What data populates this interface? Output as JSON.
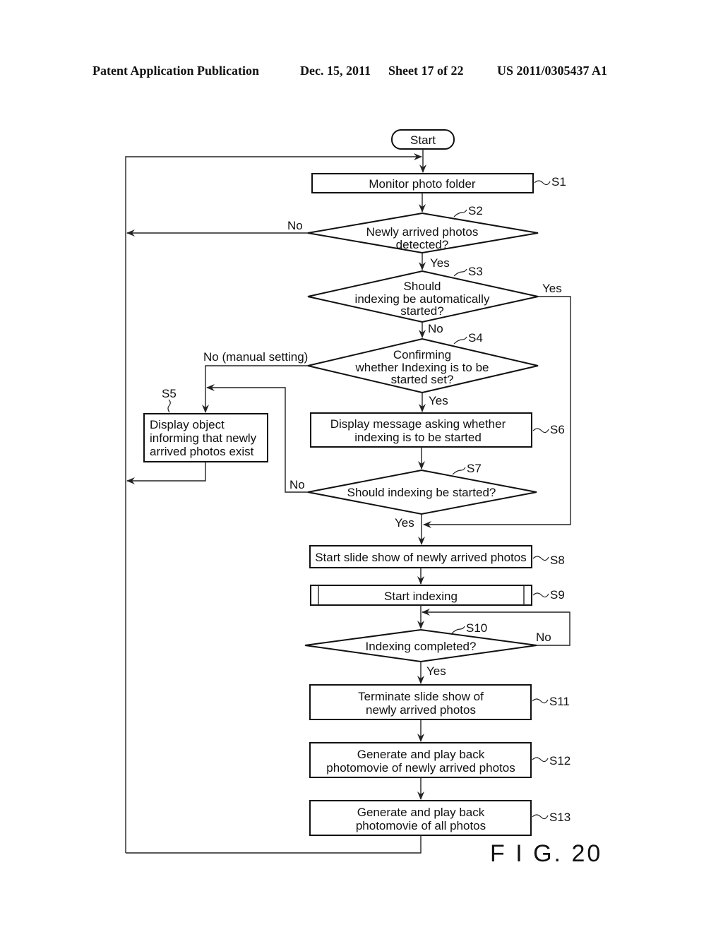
{
  "header": {
    "publication": "Patent Application Publication",
    "date": "Dec. 15, 2011",
    "sheet": "Sheet 17 of 22",
    "number": "US 2011/0305437 A1"
  },
  "figure_label": "F I G. 20",
  "start": "Start",
  "steps": {
    "s1": {
      "id": "S1",
      "lines": [
        "Monitor photo folder"
      ]
    },
    "s2": {
      "id": "S2",
      "lines": [
        "Newly arrived photos",
        "detected?"
      ]
    },
    "s3": {
      "id": "S3",
      "lines": [
        "Should",
        "indexing be automatically",
        "started?"
      ]
    },
    "s4": {
      "id": "S4",
      "lines": [
        "Confirming",
        "whether Indexing is to be",
        "started set?"
      ]
    },
    "s5": {
      "id": "S5",
      "lines": [
        "Display object",
        "informing that newly",
        "arrived photos exist"
      ]
    },
    "s6": {
      "id": "S6",
      "lines": [
        "Display message asking whether",
        "indexing is to be started"
      ]
    },
    "s7": {
      "id": "S7",
      "lines": [
        "Should indexing be started?"
      ]
    },
    "s8": {
      "id": "S8",
      "lines": [
        "Start slide show of newly arrived photos"
      ]
    },
    "s9": {
      "id": "S9",
      "lines": [
        "Start indexing"
      ]
    },
    "s10": {
      "id": "S10",
      "lines": [
        "Indexing completed?"
      ]
    },
    "s11": {
      "id": "S11",
      "lines": [
        "Terminate slide show of",
        "newly arrived photos"
      ]
    },
    "s12": {
      "id": "S12",
      "lines": [
        "Generate and play back",
        "photomovie of newly arrived photos"
      ]
    },
    "s13": {
      "id": "S13",
      "lines": [
        "Generate and play back",
        "photomovie of all photos"
      ]
    }
  },
  "edge_labels": {
    "s2_no": "No",
    "s2_yes": "Yes",
    "s3_yes": "Yes",
    "s3_no": "No",
    "s4_no": "No (manual setting)",
    "s4_yes": "Yes",
    "s7_no": "No",
    "s7_yes": "Yes",
    "s10_no": "No",
    "s10_yes": "Yes"
  }
}
